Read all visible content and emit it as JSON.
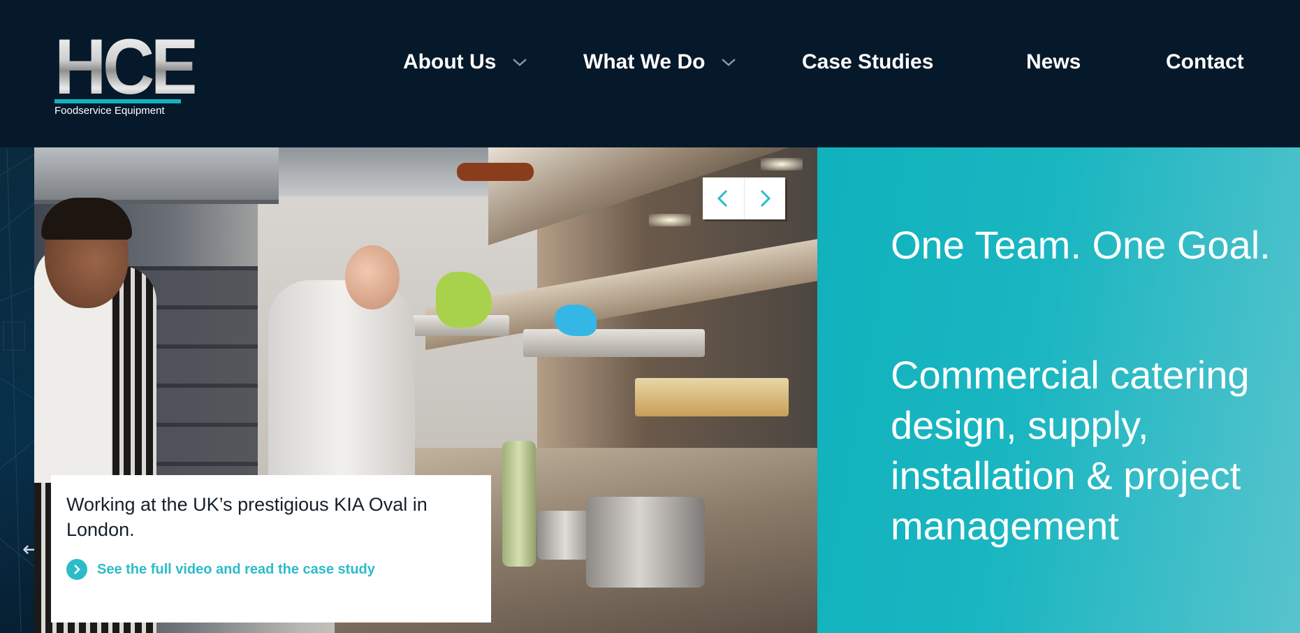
{
  "logo": {
    "letters": "HCE",
    "subtitle": "Foodservice Equipment"
  },
  "nav": {
    "items": [
      {
        "label": "About Us",
        "has_dropdown": true
      },
      {
        "label": "What We Do",
        "has_dropdown": true
      },
      {
        "label": "Case Studies",
        "has_dropdown": false
      },
      {
        "label": "News",
        "has_dropdown": false
      },
      {
        "label": "Contact",
        "has_dropdown": false
      }
    ]
  },
  "slider": {
    "prev_icon": "chevron-left-icon",
    "next_icon": "chevron-right-icon",
    "left_arrow": "←"
  },
  "caption": {
    "text": "Working at the UK’s prestigious KIA Oval in London.",
    "link_label": "See the full video and read the case study",
    "link_icon": "chevron-right-circle-icon"
  },
  "hero": {
    "tagline": "One Team. One Goal.",
    "description": "Commercial catering design, supply, installation & project management"
  },
  "colors": {
    "header_bg": "#06192a",
    "accent": "#13b3c0",
    "white": "#ffffff"
  }
}
